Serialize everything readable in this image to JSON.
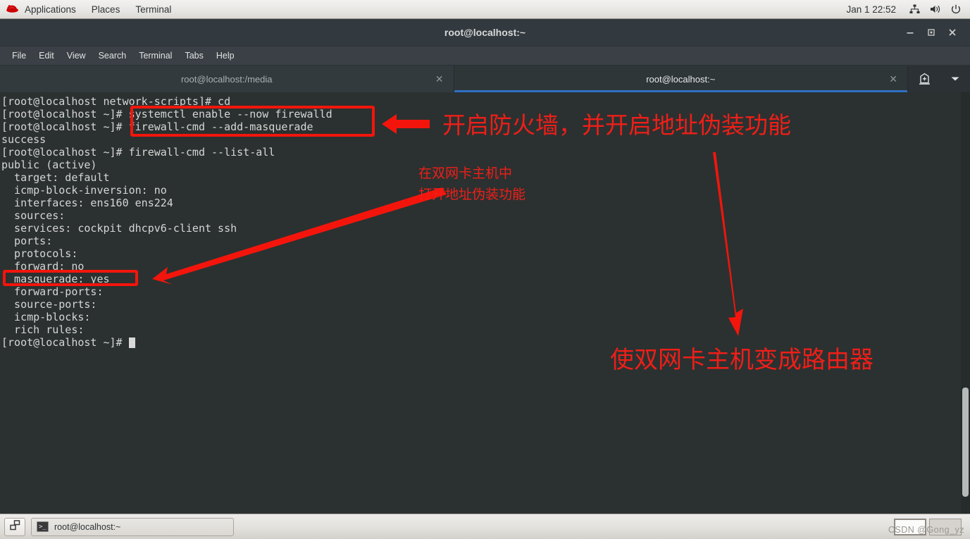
{
  "top_panel": {
    "logo_icon": "redhat-logo-icon",
    "menus": [
      "Applications",
      "Places",
      "Terminal"
    ],
    "clock": "Jan 1  22:52",
    "tray_icons": [
      "network-icon",
      "volume-icon",
      "power-icon"
    ]
  },
  "window": {
    "title": "root@localhost:~",
    "controls": {
      "minimize": "–",
      "maximize": "□",
      "close": "✕"
    },
    "menu_bar": [
      "File",
      "Edit",
      "View",
      "Search",
      "Terminal",
      "Tabs",
      "Help"
    ],
    "tabs": [
      {
        "label": "root@localhost:/media",
        "active": false,
        "close": "✕"
      },
      {
        "label": "root@localhost:~",
        "active": true,
        "close": "✕"
      }
    ],
    "tab_tools": [
      "new-tab-icon",
      "tab-list-dropdown-icon"
    ]
  },
  "terminal": {
    "prompt_user": "[root@localhost",
    "lines": [
      "[root@localhost network-scripts]# cd",
      "[root@localhost ~]# systemctl enable --now firewalld",
      "[root@localhost ~]# firewall-cmd --add-masquerade",
      "success",
      "[root@localhost ~]# firewall-cmd --list-all",
      "public (active)",
      "  target: default",
      "  icmp-block-inversion: no",
      "  interfaces: ens160 ens224",
      "  sources:",
      "  services: cockpit dhcpv6-client ssh",
      "  ports:",
      "  protocols:",
      "  forward: no",
      "  masquerade: yes",
      "  forward-ports:",
      "  source-ports:",
      "  icmp-blocks:",
      "  rich rules:"
    ],
    "last_prompt": "[root@localhost ~]# ",
    "cursor": "block-cursor"
  },
  "annotations": {
    "color": "#f3150c",
    "note_top": "开启防火墙，并开启地址伪装功能",
    "note_mid_line1": "在双网卡主机中",
    "note_mid_line2": "打开地址伪装功能",
    "note_bottom": "使双网卡主机变成路由器",
    "boxes": [
      "commands-highlight-box",
      "masquerade-highlight-box"
    ],
    "arrows": [
      "arrow-left-to-commands",
      "arrow-diagonal-to-masquerade",
      "arrow-down-to-router-note"
    ]
  },
  "taskbar": {
    "show_desktop_icon": "show-desktop-icon",
    "window_button": {
      "icon": "terminal-icon",
      "label": "root@localhost:~"
    },
    "workspaces": [
      {
        "name": "workspace-1",
        "active": true
      },
      {
        "name": "workspace-2",
        "active": false
      }
    ],
    "watermark": "CSDN @Gong_yz"
  }
}
